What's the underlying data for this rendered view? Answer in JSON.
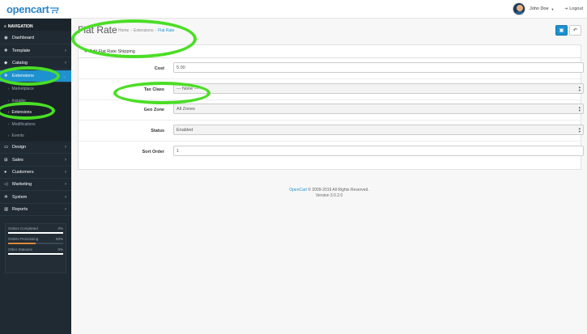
{
  "header": {
    "logo_text": "opencart",
    "user_name": "John Doe",
    "logout_label": "Logout"
  },
  "sidebar": {
    "nav_header": "NAVIGATION",
    "items": [
      {
        "label": "Dashboard",
        "icon": "dashboard-icon"
      },
      {
        "label": "Template",
        "icon": "puzzle-icon"
      },
      {
        "label": "Catalog",
        "icon": "tag-icon"
      },
      {
        "label": "Extensions",
        "icon": "puzzle-icon",
        "active": true
      },
      {
        "label": "Design",
        "icon": "monitor-icon"
      },
      {
        "label": "Sales",
        "icon": "cart-icon"
      },
      {
        "label": "Customers",
        "icon": "user-icon"
      },
      {
        "label": "Marketing",
        "icon": "share-icon"
      },
      {
        "label": "System",
        "icon": "gear-icon"
      },
      {
        "label": "Reports",
        "icon": "chart-icon"
      }
    ],
    "sub_items": [
      {
        "label": "Marketplace"
      },
      {
        "label": "Installer"
      },
      {
        "label": "Extensions",
        "current": true
      },
      {
        "label": "Modifications"
      },
      {
        "label": "Events"
      }
    ],
    "stats": [
      {
        "label": "Orders Completed",
        "value": "0%",
        "fill": 0
      },
      {
        "label": "Orders Processing",
        "value": "50%",
        "fill": 0.5
      },
      {
        "label": "Other Statuses",
        "value": "0%",
        "fill": 0
      }
    ]
  },
  "page": {
    "title": "Flat Rate",
    "breadcrumb": [
      "Home",
      "Extensions",
      "Flat Rate"
    ],
    "panel_heading": "Edit Flat Rate Shipping"
  },
  "form": {
    "cost": {
      "label": "Cost",
      "value": "5.00"
    },
    "tax_class": {
      "label": "Tax Class",
      "value": "--- None ---"
    },
    "geo_zone": {
      "label": "Geo Zone",
      "value": "All Zones"
    },
    "status": {
      "label": "Status",
      "value": "Enabled"
    },
    "sort_order": {
      "label": "Sort Order",
      "value": "1"
    }
  },
  "footer": {
    "link": "OpenCart",
    "copyright": " © 2009-2019 All Rights Reserved.",
    "version": "Version 3.0.2.0"
  },
  "colors": {
    "accent": "#1e91cf",
    "sidebar_bg": "#1f2a33",
    "highlight": "#4ade25"
  }
}
